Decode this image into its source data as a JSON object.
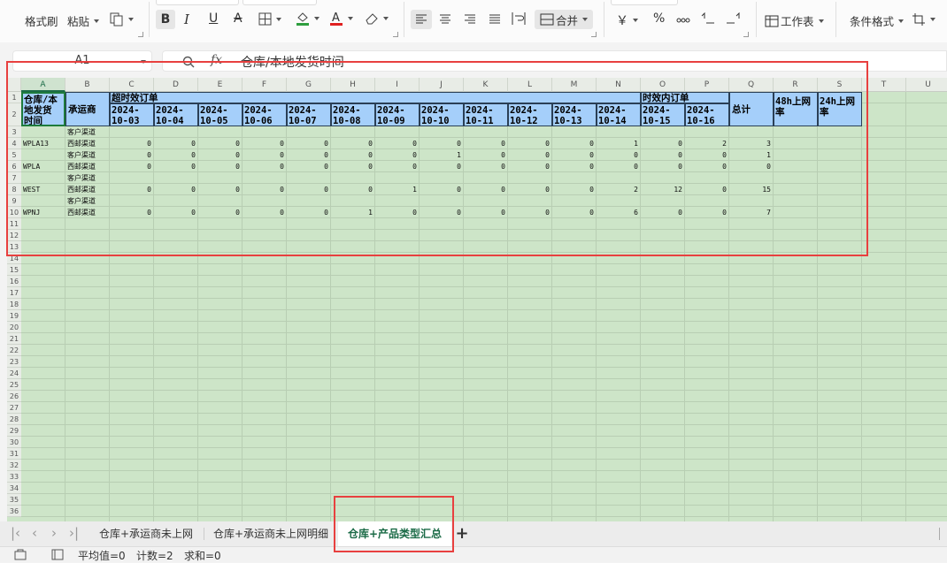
{
  "ribbon": {
    "format_painter": "格式刷",
    "paste": "粘贴",
    "merge": "合并",
    "worksheet": "工作表",
    "conditional_format": "条件格式",
    "currency_symbol": "￥",
    "percent_symbol": "%"
  },
  "formula_bar": {
    "cell_ref": "A1",
    "fx": "fx",
    "content": "仓库/本地发货时间"
  },
  "columns": [
    "A",
    "B",
    "C",
    "D",
    "E",
    "F",
    "G",
    "H",
    "I",
    "J",
    "K",
    "L",
    "M",
    "N",
    "O",
    "P",
    "Q",
    "R",
    "S",
    "T",
    "U"
  ],
  "rows": [
    "1",
    "2",
    "3",
    "4",
    "5",
    "6",
    "7",
    "8",
    "9",
    "10",
    "11",
    "12",
    "13",
    "14",
    "15",
    "16",
    "17",
    "18",
    "19",
    "20",
    "21",
    "22",
    "23",
    "24",
    "25",
    "26",
    "27",
    "28",
    "29",
    "30",
    "31",
    "32",
    "33",
    "34",
    "35",
    "36"
  ],
  "header": {
    "a1": [
      "仓库/本",
      "地发货",
      "时间"
    ],
    "b1": "承运商",
    "group1": "超时效订单",
    "group2": "时效内订单",
    "total": "总计",
    "rate48": [
      "48h上网",
      "率"
    ],
    "rate24": [
      "24h上网",
      "率"
    ],
    "dates": [
      [
        "2024-",
        "10-03"
      ],
      [
        "2024-",
        "10-04"
      ],
      [
        "2024-",
        "10-05"
      ],
      [
        "2024-",
        "10-06"
      ],
      [
        "2024-",
        "10-07"
      ],
      [
        "2024-",
        "10-08"
      ],
      [
        "2024-",
        "10-09"
      ],
      [
        "2024-",
        "10-10"
      ],
      [
        "2024-",
        "10-11"
      ],
      [
        "2024-",
        "10-12"
      ],
      [
        "2024-",
        "10-13"
      ],
      [
        "2024-",
        "10-14"
      ],
      [
        "2024-",
        "10-15"
      ],
      [
        "2024-",
        "10-16"
      ]
    ]
  },
  "data_rows": [
    {
      "row": "3",
      "warehouse": "",
      "carrier": "客户渠道",
      "values": null
    },
    {
      "row": "4",
      "warehouse": "WPLA13",
      "carrier": "西邮渠道",
      "values": [
        "0",
        "0",
        "0",
        "0",
        "0",
        "0",
        "0",
        "0",
        "0",
        "0",
        "0",
        "1",
        "0",
        "2",
        "3"
      ]
    },
    {
      "row": "5",
      "warehouse": "",
      "carrier": "客户渠道",
      "values": [
        "0",
        "0",
        "0",
        "0",
        "0",
        "0",
        "0",
        "1",
        "0",
        "0",
        "0",
        "0",
        "0",
        "0",
        "1"
      ]
    },
    {
      "row": "6",
      "warehouse": "WPLA",
      "carrier": "西邮渠道",
      "values": [
        "0",
        "0",
        "0",
        "0",
        "0",
        "0",
        "0",
        "0",
        "0",
        "0",
        "0",
        "0",
        "0",
        "0",
        "0"
      ]
    },
    {
      "row": "7",
      "warehouse": "",
      "carrier": "客户渠道",
      "values": null
    },
    {
      "row": "8",
      "warehouse": "WEST",
      "carrier": "西邮渠道",
      "values": [
        "0",
        "0",
        "0",
        "0",
        "0",
        "0",
        "1",
        "0",
        "0",
        "0",
        "0",
        "2",
        "12",
        "0",
        "15"
      ]
    },
    {
      "row": "9",
      "warehouse": "",
      "carrier": "客户渠道",
      "values": null
    },
    {
      "row": "10",
      "warehouse": "WPNJ",
      "carrier": "西邮渠道",
      "values": [
        "0",
        "0",
        "0",
        "0",
        "0",
        "1",
        "0",
        "0",
        "0",
        "0",
        "0",
        "6",
        "0",
        "0",
        "7"
      ]
    }
  ],
  "sheet_tabs": [
    "仓库+承运商未上网",
    "仓库+承运商未上网明细",
    "仓库+产品类型汇总"
  ],
  "add_tab": "+",
  "status": {
    "avg": "平均值=0",
    "count": "计数=2",
    "sum": "求和=0"
  },
  "colors": {
    "header_fill": "#a5cffa",
    "grid_fill": "#cde5c8",
    "active_tab_text": "#1b6b47",
    "highlight": "#e8403f"
  }
}
